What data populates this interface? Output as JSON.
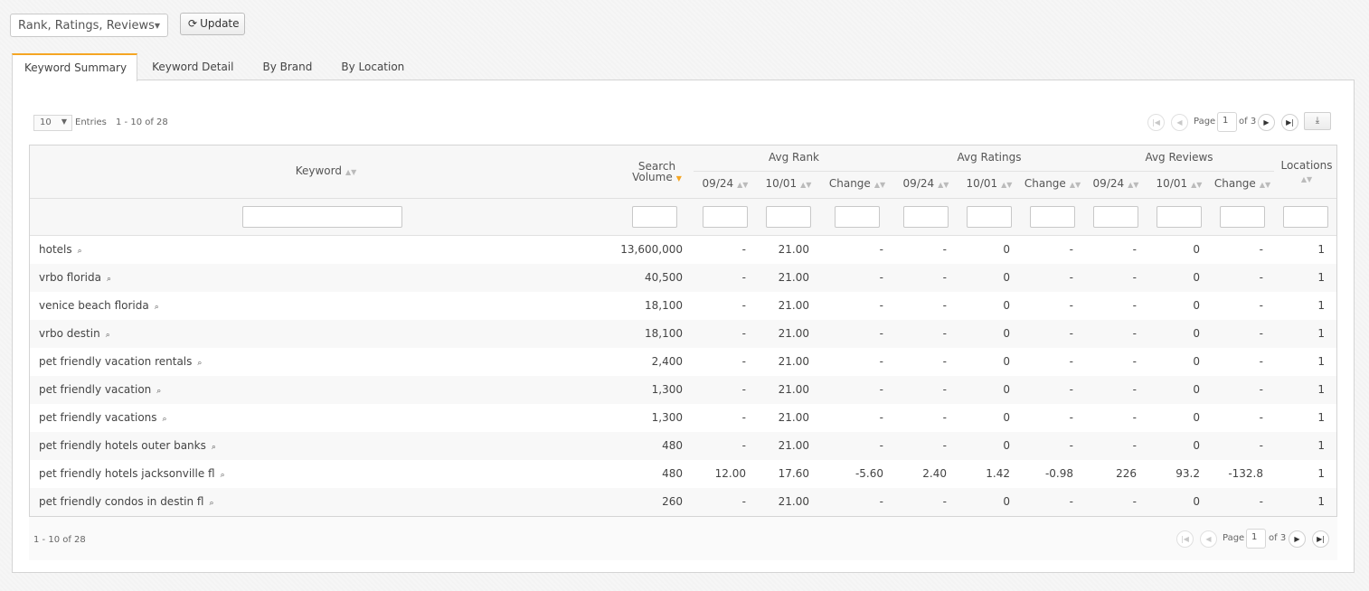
{
  "toolbar": {
    "metric_select": "Rank, Ratings, Reviews",
    "update_label": "Update"
  },
  "tabs": [
    {
      "label": "Keyword Summary"
    },
    {
      "label": "Keyword Detail"
    },
    {
      "label": "By Brand"
    },
    {
      "label": "By Location"
    }
  ],
  "pager": {
    "entries_value": "10",
    "entries_label": "Entries",
    "range": "1 - 10 of 28",
    "page_label": "Page",
    "page_value": "1",
    "of_label": "of 3"
  },
  "icons": {
    "caret": "▼",
    "refresh": "⟳",
    "first": "|◀",
    "prev": "◀",
    "next": "▶",
    "last": "▶|",
    "export": "⤓",
    "keyword_search": "⌕",
    "sort": "▲▼",
    "sort_desc": "▼"
  },
  "table": {
    "headers": {
      "keyword": "Keyword",
      "search_volume_1": "Search",
      "search_volume_2": "Volume",
      "avg_rank": "Avg Rank",
      "avg_ratings": "Avg Ratings",
      "avg_reviews": "Avg Reviews",
      "locations": "Locations",
      "d1": "09/24",
      "d2": "10/01",
      "change": "Change"
    },
    "rows": [
      {
        "keyword": "hotels",
        "volume": "13,600,000",
        "r1": "-",
        "r2": "21.00",
        "rc": "-",
        "t1": "-",
        "t2": "0",
        "tc": "-",
        "v1": "-",
        "v2": "0",
        "vc": "-",
        "loc": "1"
      },
      {
        "keyword": "vrbo florida",
        "volume": "40,500",
        "r1": "-",
        "r2": "21.00",
        "rc": "-",
        "t1": "-",
        "t2": "0",
        "tc": "-",
        "v1": "-",
        "v2": "0",
        "vc": "-",
        "loc": "1"
      },
      {
        "keyword": "venice beach florida",
        "volume": "18,100",
        "r1": "-",
        "r2": "21.00",
        "rc": "-",
        "t1": "-",
        "t2": "0",
        "tc": "-",
        "v1": "-",
        "v2": "0",
        "vc": "-",
        "loc": "1"
      },
      {
        "keyword": "vrbo destin",
        "volume": "18,100",
        "r1": "-",
        "r2": "21.00",
        "rc": "-",
        "t1": "-",
        "t2": "0",
        "tc": "-",
        "v1": "-",
        "v2": "0",
        "vc": "-",
        "loc": "1"
      },
      {
        "keyword": "pet friendly vacation rentals",
        "volume": "2,400",
        "r1": "-",
        "r2": "21.00",
        "rc": "-",
        "t1": "-",
        "t2": "0",
        "tc": "-",
        "v1": "-",
        "v2": "0",
        "vc": "-",
        "loc": "1"
      },
      {
        "keyword": "pet friendly vacation",
        "volume": "1,300",
        "r1": "-",
        "r2": "21.00",
        "rc": "-",
        "t1": "-",
        "t2": "0",
        "tc": "-",
        "v1": "-",
        "v2": "0",
        "vc": "-",
        "loc": "1"
      },
      {
        "keyword": "pet friendly vacations",
        "volume": "1,300",
        "r1": "-",
        "r2": "21.00",
        "rc": "-",
        "t1": "-",
        "t2": "0",
        "tc": "-",
        "v1": "-",
        "v2": "0",
        "vc": "-",
        "loc": "1"
      },
      {
        "keyword": "pet friendly hotels outer banks",
        "volume": "480",
        "r1": "-",
        "r2": "21.00",
        "rc": "-",
        "t1": "-",
        "t2": "0",
        "tc": "-",
        "v1": "-",
        "v2": "0",
        "vc": "-",
        "loc": "1"
      },
      {
        "keyword": "pet friendly hotels jacksonville fl",
        "volume": "480",
        "r1": "12.00",
        "r2": "17.60",
        "rc": "-5.60",
        "t1": "2.40",
        "t2": "1.42",
        "tc": "-0.98",
        "v1": "226",
        "v2": "93.2",
        "vc": "-132.8",
        "loc": "1"
      },
      {
        "keyword": "pet friendly condos in destin fl",
        "volume": "260",
        "r1": "-",
        "r2": "21.00",
        "rc": "-",
        "t1": "-",
        "t2": "0",
        "tc": "-",
        "v1": "-",
        "v2": "0",
        "vc": "-",
        "loc": "1"
      }
    ]
  },
  "colors": {
    "accent": "#f5a623"
  }
}
